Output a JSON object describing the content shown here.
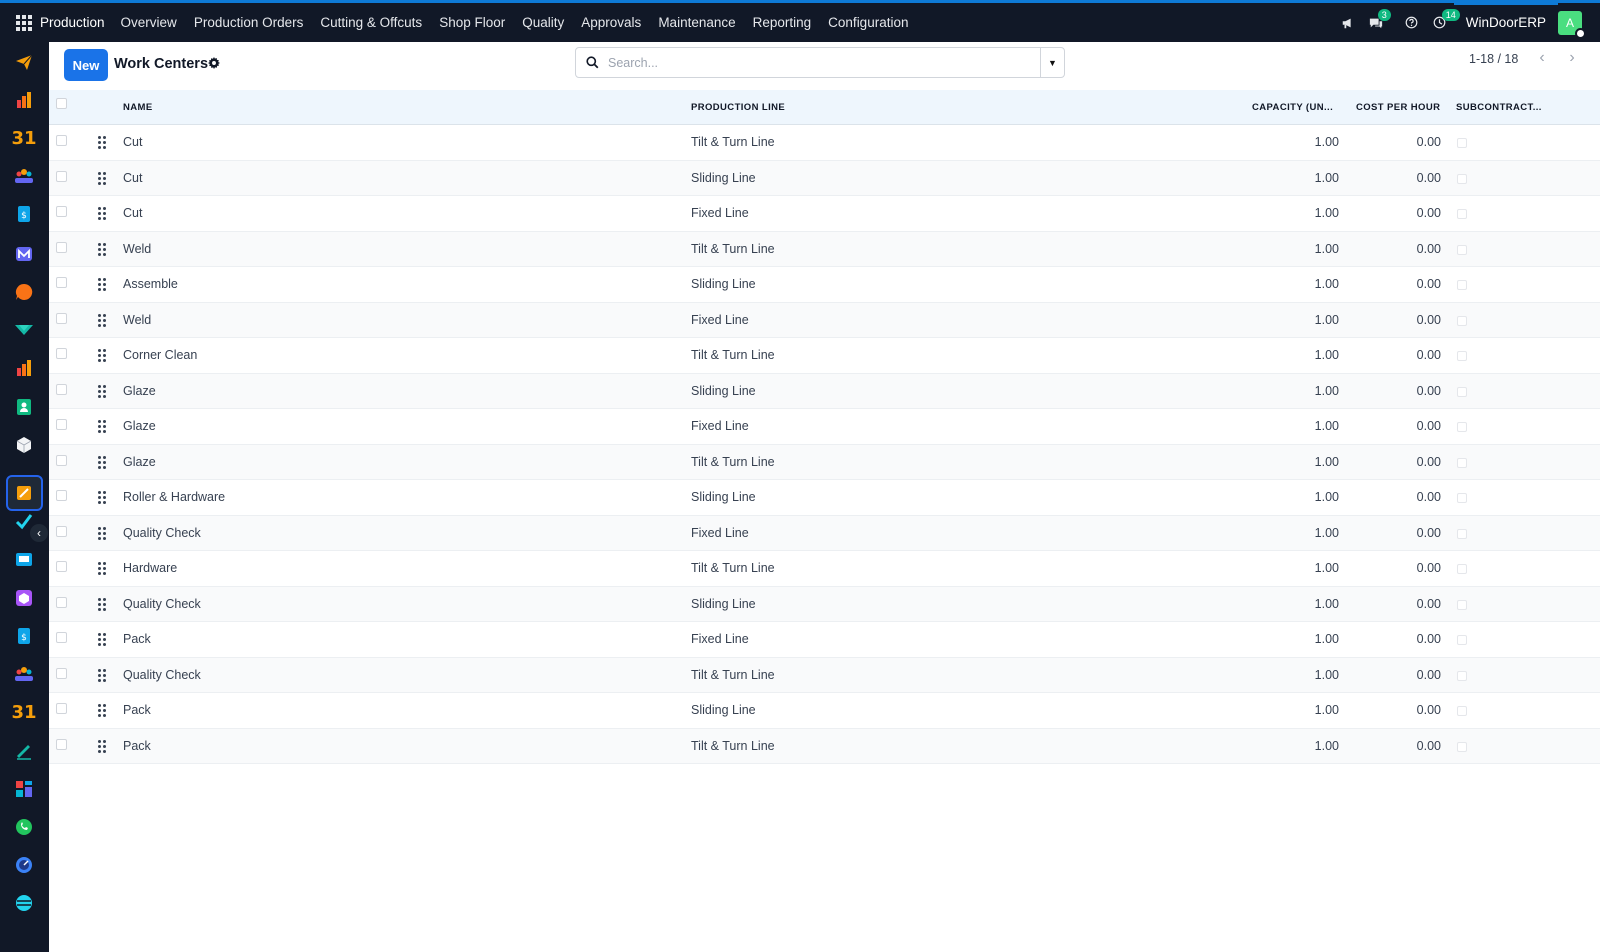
{
  "app": {
    "name": "Production",
    "menu": [
      "Overview",
      "Production Orders",
      "Cutting & Offcuts",
      "Shop Floor",
      "Quality",
      "Approvals",
      "Maintenance",
      "Reporting",
      "Configuration"
    ],
    "messages_count": "3",
    "activities_count": "14",
    "company": "WinDoorERP",
    "avatar_letter": "A"
  },
  "sidebar_icons": [
    "send-icon",
    "bar-chart-icon",
    "calendar-31-icon",
    "people-icon",
    "invoice-icon",
    "mail-m-icon",
    "chat-bubble-icon",
    "marketing-icon",
    "chart-icon",
    "contacts-icon",
    "cube-icon",
    "manufacturing-icon",
    "checkmark-icon",
    "elearning-icon",
    "package-icon",
    "invoice-icon",
    "people-icon",
    "calendar-31-icon",
    "sign-icon",
    "dashboard-icon",
    "whatsapp-icon",
    "discuss-icon",
    "odoo-icon"
  ],
  "control": {
    "new_label": "New",
    "title": "Work Centers",
    "search_placeholder": "Search...",
    "pager": "1-18 / 18"
  },
  "table": {
    "headers": {
      "name": "NAME",
      "line": "PRODUCTION LINE",
      "capacity": "CAPACITY (UN...",
      "cost": "COST PER HOUR",
      "subcontract": "SUBCONTRACT..."
    },
    "rows": [
      {
        "name": "Cut",
        "line": "Tilt & Turn Line",
        "capacity": "1.00",
        "cost": "0.00"
      },
      {
        "name": "Cut",
        "line": "Sliding Line",
        "capacity": "1.00",
        "cost": "0.00"
      },
      {
        "name": "Cut",
        "line": "Fixed Line",
        "capacity": "1.00",
        "cost": "0.00"
      },
      {
        "name": "Weld",
        "line": "Tilt & Turn Line",
        "capacity": "1.00",
        "cost": "0.00"
      },
      {
        "name": "Assemble",
        "line": "Sliding Line",
        "capacity": "1.00",
        "cost": "0.00"
      },
      {
        "name": "Weld",
        "line": "Fixed Line",
        "capacity": "1.00",
        "cost": "0.00"
      },
      {
        "name": "Corner Clean",
        "line": "Tilt & Turn Line",
        "capacity": "1.00",
        "cost": "0.00"
      },
      {
        "name": "Glaze",
        "line": "Sliding Line",
        "capacity": "1.00",
        "cost": "0.00"
      },
      {
        "name": "Glaze",
        "line": "Fixed Line",
        "capacity": "1.00",
        "cost": "0.00"
      },
      {
        "name": "Glaze",
        "line": "Tilt & Turn Line",
        "capacity": "1.00",
        "cost": "0.00"
      },
      {
        "name": "Roller & Hardware",
        "line": "Sliding Line",
        "capacity": "1.00",
        "cost": "0.00"
      },
      {
        "name": "Quality Check",
        "line": "Fixed Line",
        "capacity": "1.00",
        "cost": "0.00"
      },
      {
        "name": "Hardware",
        "line": "Tilt & Turn Line",
        "capacity": "1.00",
        "cost": "0.00"
      },
      {
        "name": "Quality Check",
        "line": "Sliding Line",
        "capacity": "1.00",
        "cost": "0.00"
      },
      {
        "name": "Pack",
        "line": "Fixed Line",
        "capacity": "1.00",
        "cost": "0.00"
      },
      {
        "name": "Quality Check",
        "line": "Tilt & Turn Line",
        "capacity": "1.00",
        "cost": "0.00"
      },
      {
        "name": "Pack",
        "line": "Sliding Line",
        "capacity": "1.00",
        "cost": "0.00"
      },
      {
        "name": "Pack",
        "line": "Tilt & Turn Line",
        "capacity": "1.00",
        "cost": "0.00"
      }
    ]
  }
}
